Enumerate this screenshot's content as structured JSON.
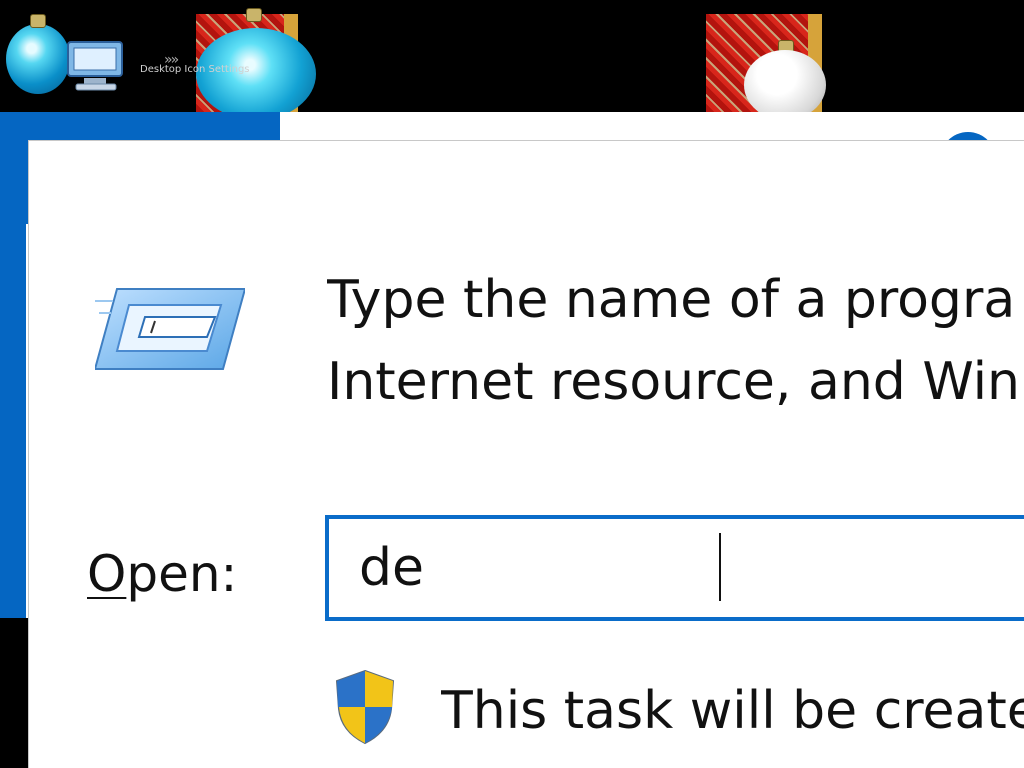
{
  "desktop": {
    "shortcut_label": "Desktop Icon Settings",
    "chevrons": "»»"
  },
  "run_dialog": {
    "prompt_line1": "Type the name of a progra",
    "prompt_line2": "Internet resource, and Win",
    "open_label_mnemonic": "O",
    "open_label_rest": "pen:",
    "open_value": "de",
    "notice_text": "This task will be create"
  },
  "colors": {
    "accent": "#0a6cc9",
    "window_blue": "#0566c2"
  },
  "icons": [
    "run-icon",
    "uac-shield-icon",
    "shortcut-icon"
  ]
}
